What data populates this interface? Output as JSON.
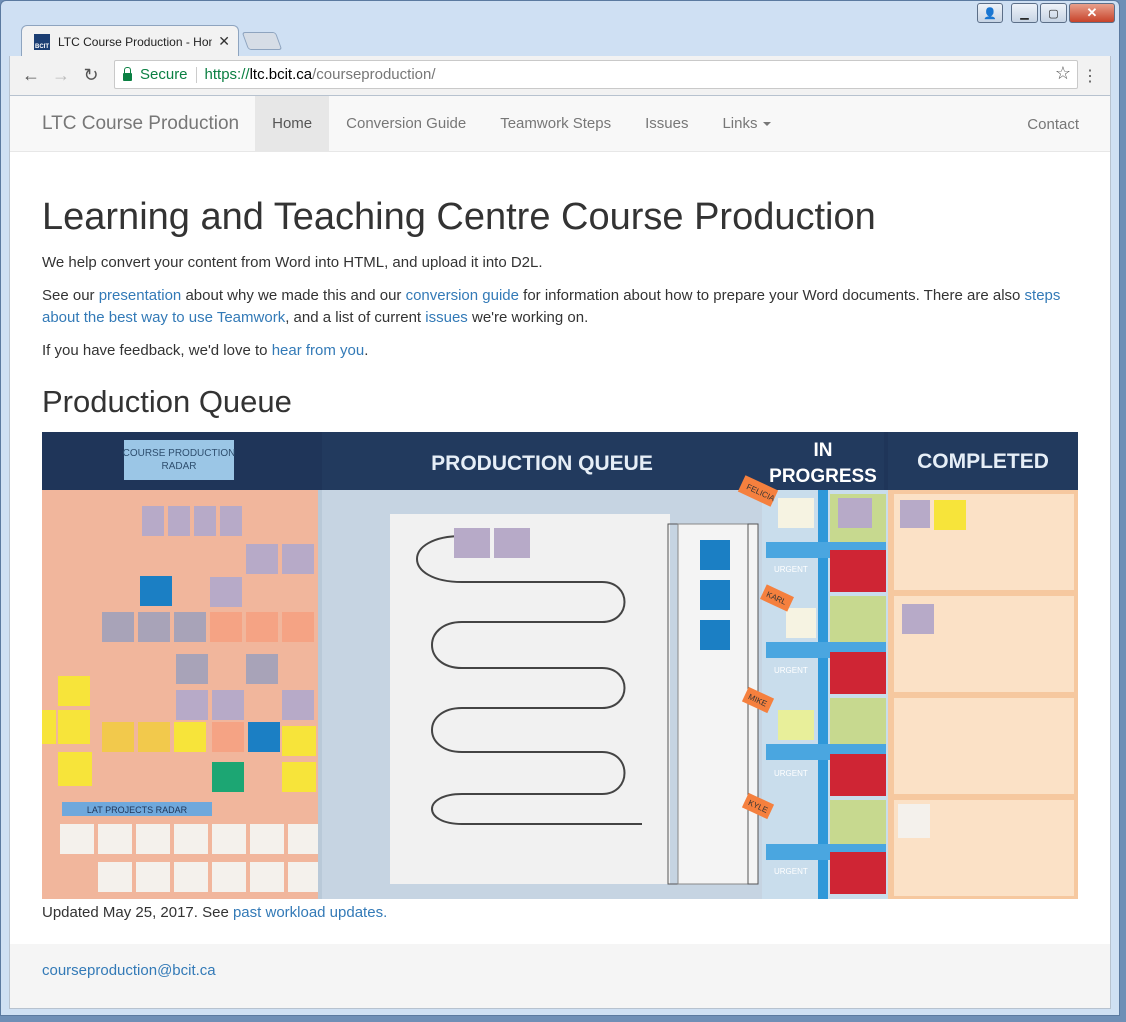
{
  "browser": {
    "tab_title": "LTC Course Production - Hom",
    "favicon_text": "BCIT",
    "secure_label": "Secure",
    "url_scheme": "https://",
    "url_host": "ltc.bcit.ca",
    "url_path": "/courseproduction/"
  },
  "nav": {
    "brand": "LTC Course Production",
    "items": [
      "Home",
      "Conversion Guide",
      "Teamwork Steps",
      "Issues",
      "Links"
    ],
    "active": "Home",
    "contact": "Contact"
  },
  "main": {
    "title": "Learning and Teaching Centre Course Production",
    "intro": "We help convert your content from Word into HTML, and upload it into D2L.",
    "p2": {
      "t1": "See our ",
      "link_presentation": "presentation",
      "t2": " about why we made this and our ",
      "link_conversion": "conversion guide",
      "t3": " for information about how to prepare your Word documents. There are also ",
      "link_teamwork": "steps about the best way to use Teamwork",
      "t4": ", and a list of current ",
      "link_issues": "issues",
      "t5": " we're working on."
    },
    "p3": {
      "t1": "If you have feedback, we'd love to ",
      "link_hear": "hear from you",
      "t2": "."
    },
    "queue_heading": "Production Queue",
    "board": {
      "radar_title_1": "COURSE PRODUCTION",
      "radar_title_2": "RADAR",
      "queue_header": "PRODUCTION QUEUE",
      "inprogress_header_1": "IN",
      "inprogress_header_2": "PROGRESS",
      "completed_header": "COMPLETED",
      "lat_radar": "LAT PROJECTS RADAR",
      "urgent": "URGENT",
      "names": [
        "FELICIA",
        "KARL",
        "MIKE",
        "KYLE"
      ]
    },
    "caption_text": "Updated May 25, 2017. See ",
    "caption_link": "past workload updates."
  },
  "footer": {
    "email": "courseproduction@bcit.ca"
  }
}
